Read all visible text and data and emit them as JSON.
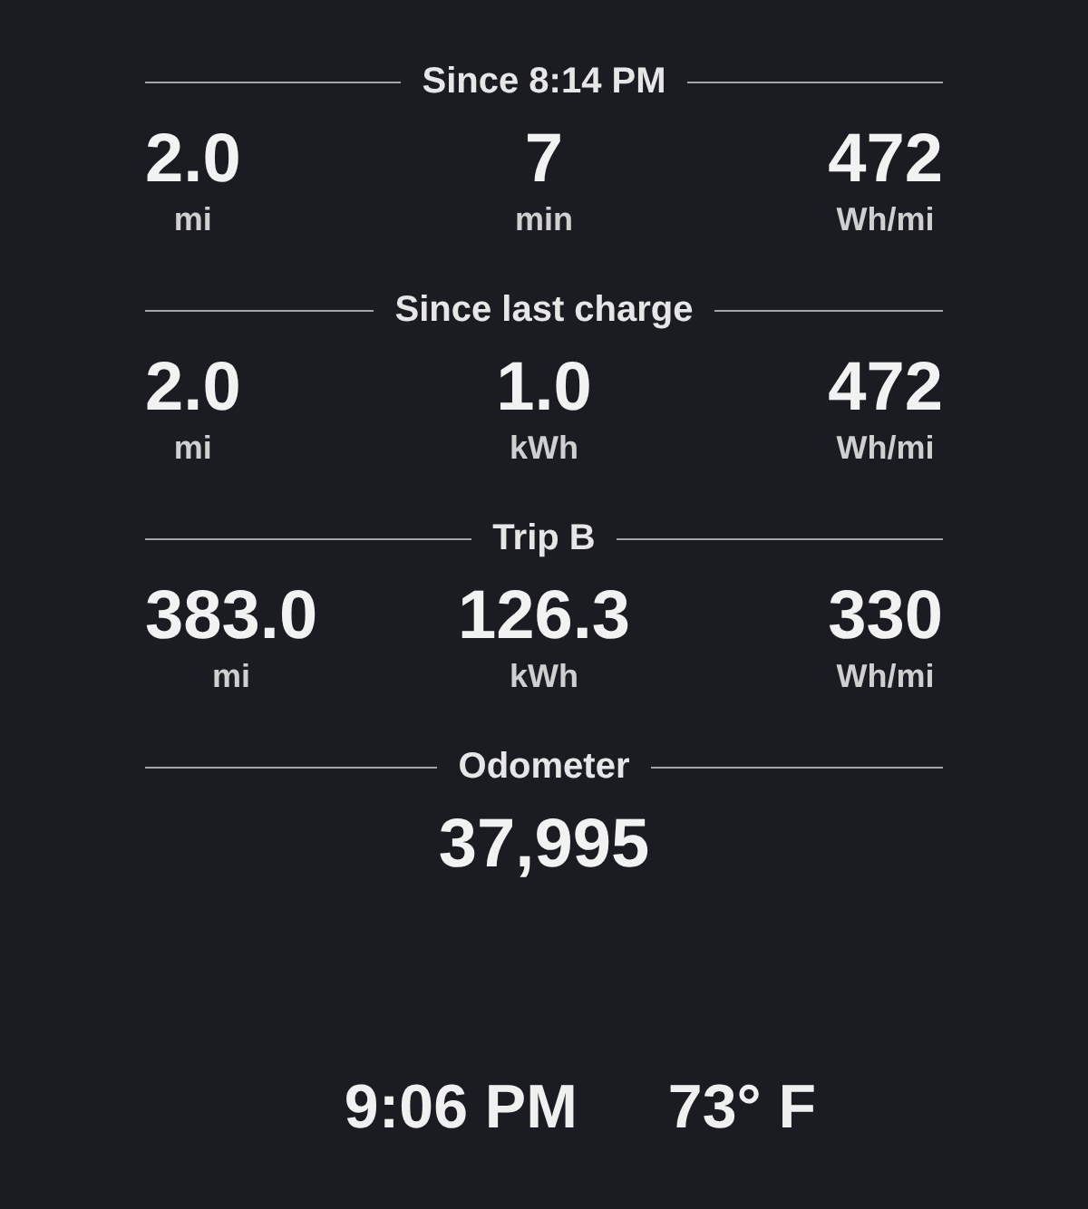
{
  "sections": [
    {
      "title": "Since 8:14 PM",
      "stats": [
        {
          "value": "2.0",
          "unit": "mi"
        },
        {
          "value": "7",
          "unit": "min"
        },
        {
          "value": "472",
          "unit": "Wh/mi"
        }
      ]
    },
    {
      "title": "Since last charge",
      "stats": [
        {
          "value": "2.0",
          "unit": "mi"
        },
        {
          "value": "1.0",
          "unit": "kWh"
        },
        {
          "value": "472",
          "unit": "Wh/mi"
        }
      ]
    },
    {
      "title": "Trip B",
      "stats": [
        {
          "value": "383.0",
          "unit": "mi"
        },
        {
          "value": "126.3",
          "unit": "kWh"
        },
        {
          "value": "330",
          "unit": "Wh/mi"
        }
      ]
    },
    {
      "title": "Odometer",
      "stats": [
        {
          "value": "37,995"
        }
      ]
    }
  ],
  "status_bar": {
    "time": "9:06 PM",
    "temperature": "73° F"
  }
}
